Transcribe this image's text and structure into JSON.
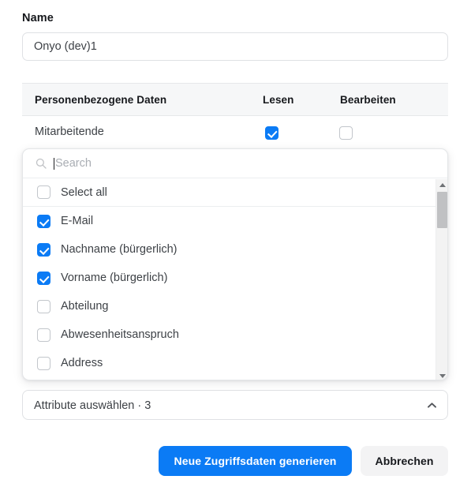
{
  "form": {
    "name_label": "Name",
    "name_value": "Onyo (dev)1",
    "name_placeholder": "Name"
  },
  "table": {
    "headers": {
      "category": "Personenbezogene Daten",
      "read": "Lesen",
      "edit": "Bearbeiten"
    },
    "rows": [
      {
        "label": "Mitarbeitende",
        "read": true,
        "edit": false
      }
    ]
  },
  "attribute_select": {
    "trigger_label": "Attribute auswählen · 3",
    "selected_count": 3,
    "expanded": true,
    "chevron": "chevron-up-icon"
  },
  "dropdown": {
    "search": {
      "placeholder": "Search",
      "value": "",
      "icon": "search-icon",
      "focused": true
    },
    "options": [
      {
        "label": "Select all",
        "checked": false
      },
      {
        "label": "E-Mail",
        "checked": true
      },
      {
        "label": "Nachname (bürgerlich)",
        "checked": true
      },
      {
        "label": "Vorname (bürgerlich)",
        "checked": true
      },
      {
        "label": "Abteilung",
        "checked": false
      },
      {
        "label": "Abwesenheitsanspruch",
        "checked": false
      },
      {
        "label": "Address",
        "checked": false
      }
    ],
    "scrollbar": {
      "up_icon": "scroll-up-arrow-icon",
      "down_icon": "scroll-down-arrow-icon"
    }
  },
  "footer": {
    "primary_label": "Neue Zugriffsdaten generieren",
    "secondary_label": "Abbrechen"
  },
  "colors": {
    "accent": "#0b7bf5",
    "text": "#3d4146",
    "heading": "#16181c",
    "border": "#dfe1e4",
    "header_bg": "#f6f7f8",
    "secondary_btn_bg": "#f3f3f4"
  }
}
